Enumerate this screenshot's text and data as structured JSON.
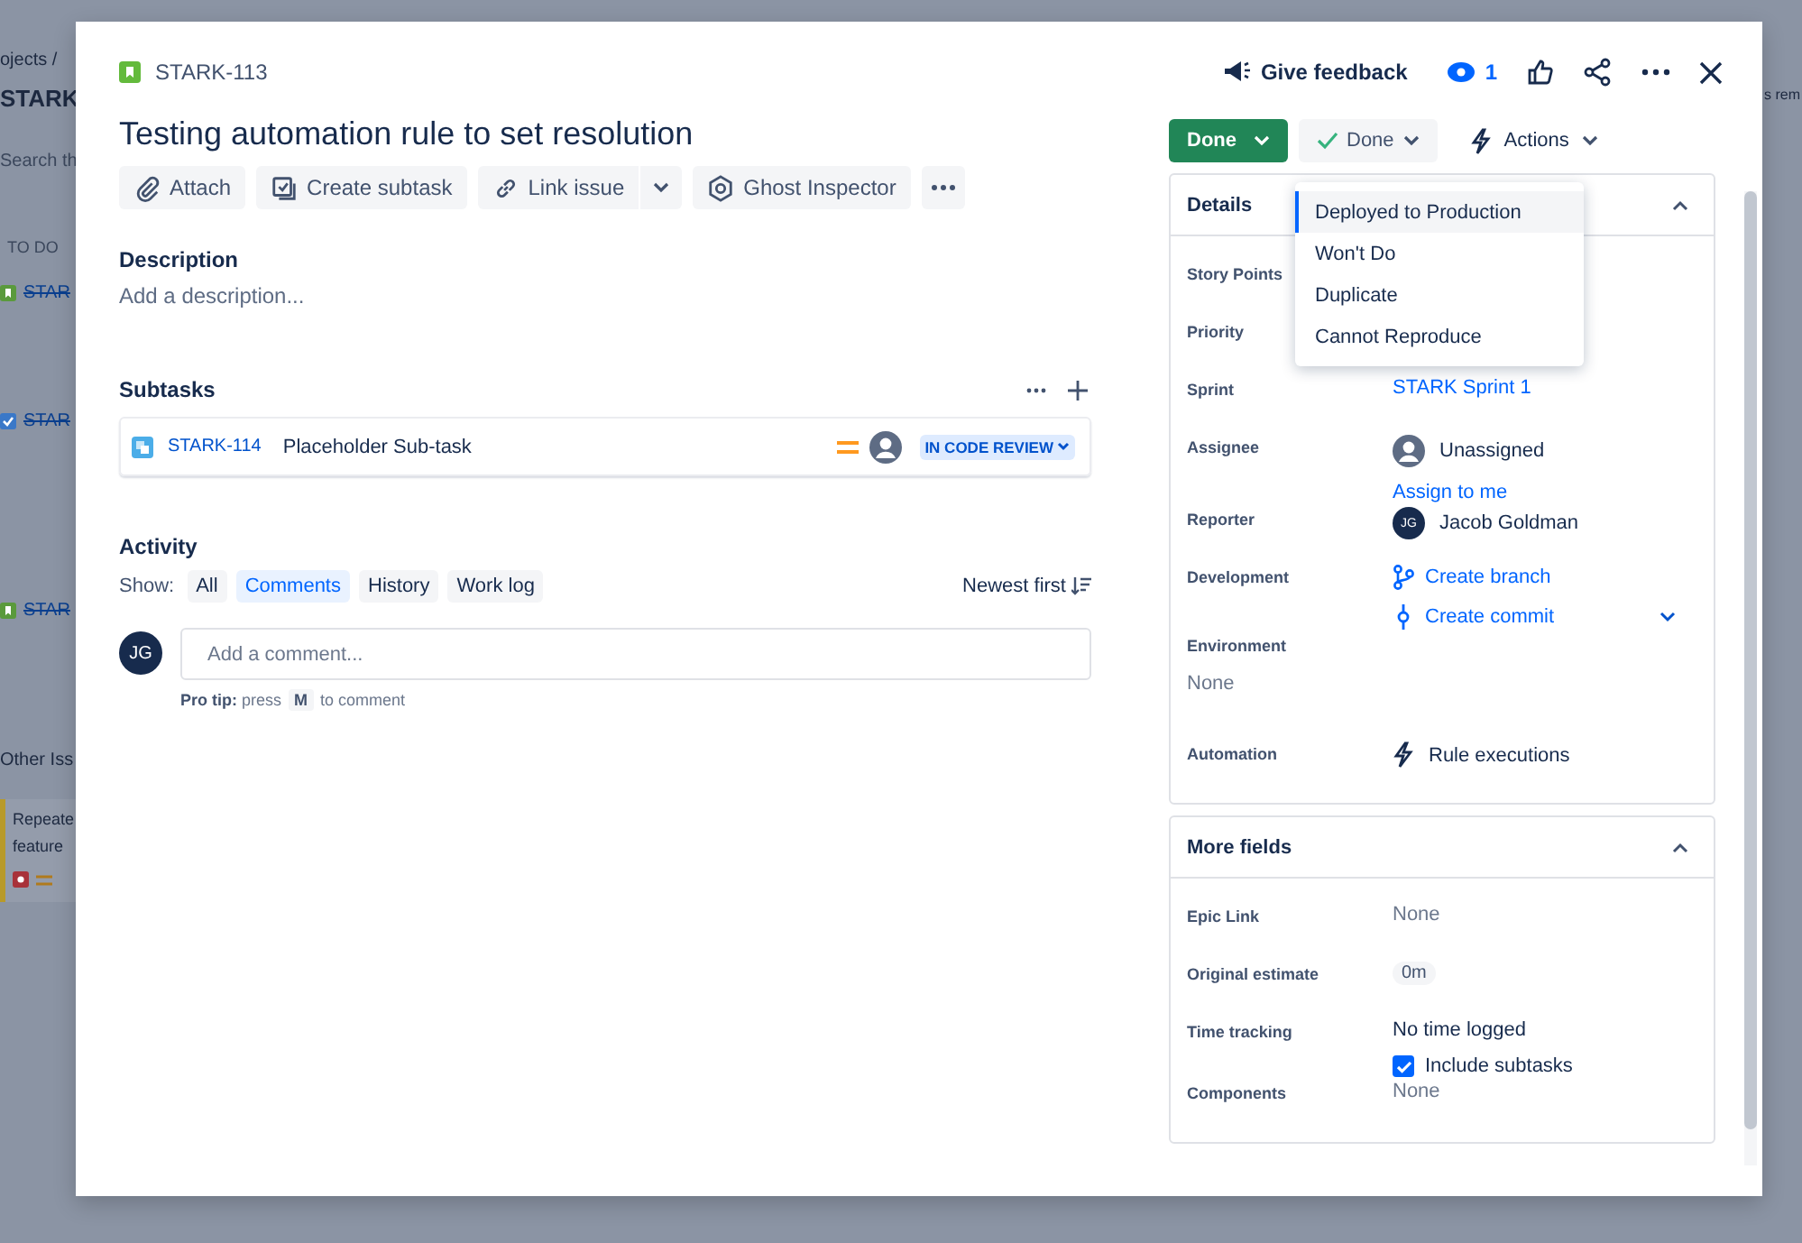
{
  "board": {
    "breadcrumb": "ojects /",
    "project": "STARK",
    "search": {
      "placeholder": "Search th"
    },
    "column_header": "TO DO",
    "cards": [
      {
        "kind": "story",
        "key": "STAR",
        "done": true
      },
      {
        "kind": "task",
        "key": "STAR",
        "done": true
      },
      {
        "kind": "story",
        "key": "STAR",
        "done": true
      }
    ],
    "section": "Other Iss",
    "bug_card": {
      "title": "Repeate feature"
    },
    "right_text": "s rem"
  },
  "issue": {
    "key": "STARK-113",
    "title": "Testing automation rule to set resolution",
    "toolbar": [
      {
        "kind": "attach",
        "label": "Attach"
      },
      {
        "kind": "subtask",
        "label": "Create subtask"
      },
      {
        "kind": "link",
        "label": "Link issue"
      },
      {
        "kind": "ghost",
        "label": "Ghost Inspector"
      }
    ],
    "description": {
      "title": "Description",
      "placeholder": "Add a description..."
    },
    "subtasks": {
      "title": "Subtasks",
      "items": [
        {
          "key": "STARK-114",
          "summary": "Placeholder Sub-task",
          "status": "IN CODE REVIEW"
        }
      ]
    },
    "activity": {
      "title": "Activity",
      "show_label": "Show:",
      "filters": [
        {
          "label": "All",
          "selected": false
        },
        {
          "label": "Comments",
          "selected": true
        },
        {
          "label": "History",
          "selected": false
        },
        {
          "label": "Work log",
          "selected": false
        }
      ],
      "sort": "Newest first",
      "comment": {
        "avatar": "JG",
        "placeholder": "Add a comment..."
      },
      "pro_tip": {
        "lead": "**Pro tip:** press",
        "key": "M",
        "tail": "to comment"
      }
    }
  },
  "header": {
    "feedback": "Give feedback",
    "watchers": "1"
  },
  "status": {
    "workflow": "Done",
    "resolution": "Done",
    "actions": "Actions",
    "menu": [
      {
        "label": "Deployed to Production",
        "selected": true
      },
      {
        "label": "Won't Do",
        "selected": false
      },
      {
        "label": "Duplicate",
        "selected": false
      },
      {
        "label": "Cannot Reproduce",
        "selected": false
      }
    ]
  },
  "details": {
    "title": "Details",
    "expanded": true,
    "fields": [
      {
        "label": "Story Points",
        "kind": "empty"
      },
      {
        "label": "Priority",
        "kind": "empty"
      },
      {
        "label": "Sprint",
        "kind": "link",
        "value": "STARK Sprint 1"
      },
      {
        "label": "Assignee",
        "kind": "unassigned",
        "value": "Unassigned",
        "action": "Assign to me"
      },
      {
        "label": "Reporter",
        "kind": "user",
        "value": "Jacob Goldman",
        "initials": "JG"
      },
      {
        "label": "Development",
        "kind": "dev",
        "links": [
          "Create branch",
          "Create commit"
        ]
      },
      {
        "label": "Environment",
        "kind": "stacked",
        "value": "None"
      },
      {
        "label": "Automation",
        "kind": "automation",
        "value": "Rule executions"
      }
    ]
  },
  "more_fields": {
    "title": "More fields",
    "expanded": true,
    "fields": [
      {
        "label": "Epic Link",
        "kind": "muted",
        "value": "None"
      },
      {
        "label": "Original estimate",
        "kind": "badge",
        "value": "0m"
      },
      {
        "label": "Time tracking",
        "kind": "tracking",
        "value": "No time logged",
        "checkbox": {
          "label": "Include subtasks",
          "checked": true
        }
      },
      {
        "label": "Components",
        "kind": "muted",
        "value": "None"
      }
    ]
  }
}
